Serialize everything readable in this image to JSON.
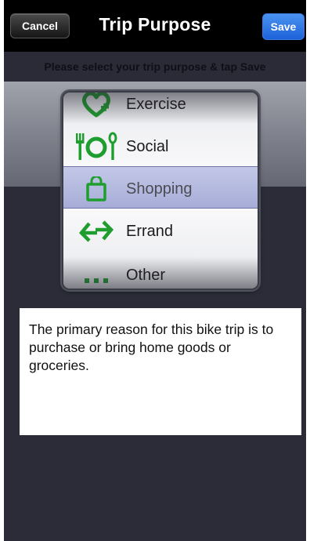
{
  "navbar": {
    "title": "Trip Purpose",
    "cancel_label": "Cancel",
    "save_label": "Save"
  },
  "instruction": "Please select your trip purpose & tap Save",
  "picker": {
    "items": [
      {
        "label": "Exercise",
        "icon": "heart-plus-icon"
      },
      {
        "label": "Social",
        "icon": "fork-plate-spoon-icon"
      },
      {
        "label": "Shopping",
        "icon": "shopping-bag-icon"
      },
      {
        "label": "Errand",
        "icon": "double-arrow-icon"
      },
      {
        "label": "Other",
        "icon": "ellipsis-icon"
      }
    ],
    "selected": "Shopping"
  },
  "description": "The primary reason for this bike trip is to purchase or bring home goods or groceries.",
  "colors": {
    "icon_green": "#1f9e2f",
    "save_blue": "#2f75e6",
    "background": "#2b2c38"
  }
}
